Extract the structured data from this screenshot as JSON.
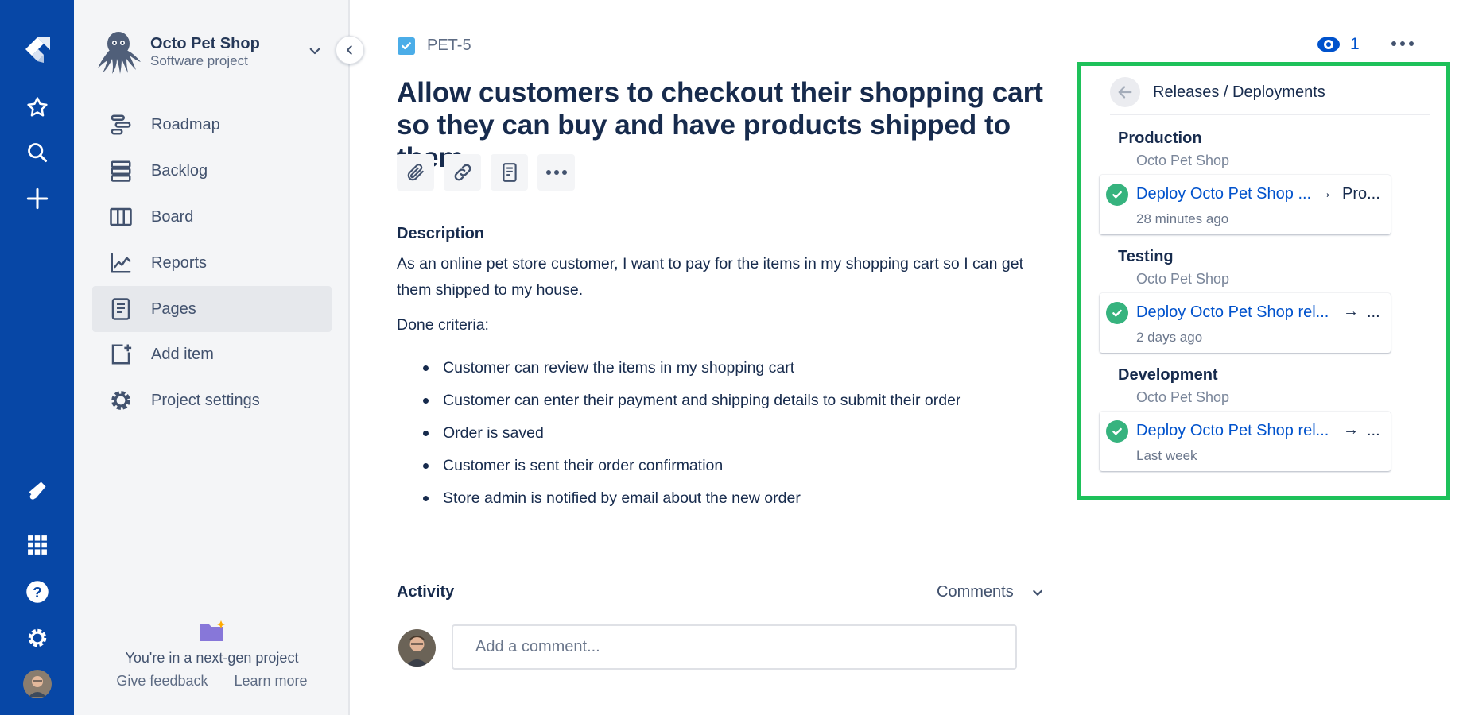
{
  "global_nav": {
    "icons": [
      "jira-logo-icon",
      "star-icon",
      "search-icon",
      "create-plus-icon",
      "notifications-megaphone-icon",
      "app-switcher-icon",
      "help-icon",
      "settings-gear-icon",
      "user-avatar"
    ]
  },
  "project": {
    "name": "Octo Pet Shop",
    "type": "Software project"
  },
  "sidebar": {
    "items": [
      {
        "label": "Roadmap",
        "icon": "roadmap-icon"
      },
      {
        "label": "Backlog",
        "icon": "backlog-icon"
      },
      {
        "label": "Board",
        "icon": "board-icon"
      },
      {
        "label": "Reports",
        "icon": "reports-icon"
      },
      {
        "label": "Pages",
        "icon": "pages-icon",
        "active": true
      },
      {
        "label": "Add item",
        "icon": "add-item-icon"
      },
      {
        "label": "Project settings",
        "icon": "settings-icon"
      }
    ],
    "nextgen_text": "You're in a next-gen project",
    "give_feedback": "Give feedback",
    "learn_more": "Learn more"
  },
  "issue": {
    "key": "PET-5",
    "title": "Allow customers to checkout their shopping cart so they can buy and have products shipped to them",
    "description_heading": "Description",
    "description": "As an online pet store customer, I want to pay for the items in my shopping cart so I can get them shipped to my house.",
    "done_label": "Done criteria:",
    "criteria": [
      "Customer can review the items in my shopping cart",
      "Customer can enter their payment and shipping details to submit their order",
      "Order is saved",
      "Customer is sent their order confirmation",
      "Store admin is notified by email about the new order"
    ],
    "watchers": "1"
  },
  "activity": {
    "heading": "Activity",
    "filter": "Comments",
    "comment_placeholder": "Add a comment..."
  },
  "releases": {
    "title": "Releases / Deployments",
    "environments": [
      {
        "name": "Production",
        "project": "Octo Pet Shop",
        "deploy": "Deploy Octo Pet Shop ...",
        "target": "Pro...",
        "time": "28 minutes ago",
        "status_color": "#36b37e"
      },
      {
        "name": "Testing",
        "project": "Octo Pet Shop",
        "deploy": "Deploy Octo Pet Shop rel...",
        "target": "...",
        "time": "2 days ago",
        "status_color": "#36b37e"
      },
      {
        "name": "Development",
        "project": "Octo Pet Shop",
        "deploy": "Deploy Octo Pet Shop rel...",
        "target": "...",
        "time": "Last week",
        "status_color": "#36b37e"
      }
    ]
  },
  "colors": {
    "nav_blue": "#0747a6",
    "link_blue": "#0052cc",
    "success_green": "#36b37e",
    "highlight_green": "#1ec15a"
  }
}
